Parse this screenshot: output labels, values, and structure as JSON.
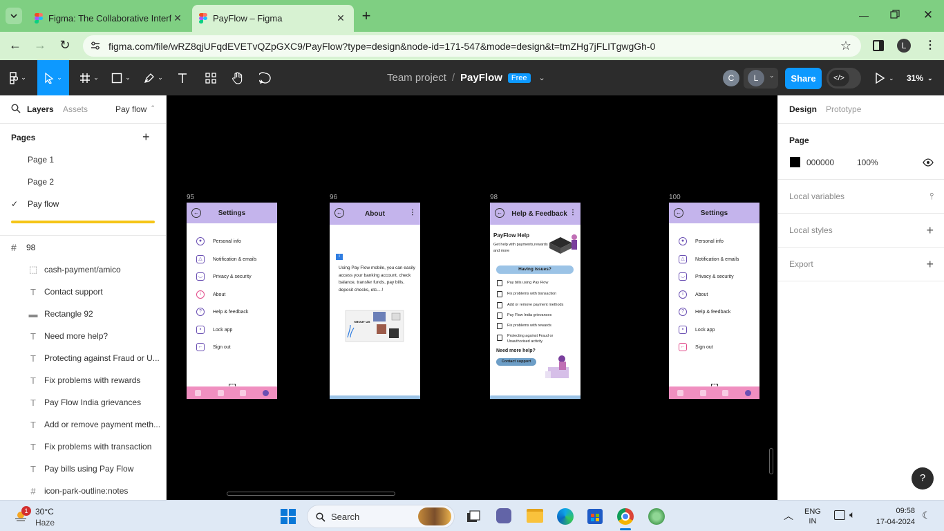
{
  "browser": {
    "tabs": [
      {
        "title": "Figma: The Collaborative Interf",
        "active": false
      },
      {
        "title": "PayFlow – Figma",
        "active": true
      }
    ],
    "url": "figma.com/file/wRZ8qjUFqdEVETvQZpGXC9/PayFlow?type=design&node-id=171-547&mode=design&t=tmZHg7jFLITgwgGh-0",
    "avatar_letter": "L"
  },
  "figma_toolbar": {
    "team": "Team project",
    "separator": "/",
    "file": "PayFlow",
    "plan_badge": "Free",
    "collab_1": "C",
    "collab_2": "L",
    "share_label": "Share",
    "zoom": "31%"
  },
  "left_panel": {
    "tab_layers": "Layers",
    "tab_assets": "Assets",
    "page_selector": "Pay flow",
    "pages_heading": "Pages",
    "pages": [
      "Page 1",
      "Page 2",
      "Pay flow"
    ],
    "frame_name": "98",
    "layers": [
      {
        "icon": "frame-dashed",
        "name": "cash-payment/amico"
      },
      {
        "icon": "text",
        "name": "Contact support"
      },
      {
        "icon": "rectangle",
        "name": "Rectangle 92"
      },
      {
        "icon": "text",
        "name": "Need more help?"
      },
      {
        "icon": "text",
        "name": "Protecting against Fraud or U..."
      },
      {
        "icon": "text",
        "name": "Fix problems with rewards"
      },
      {
        "icon": "text",
        "name": "Pay Flow India grievances"
      },
      {
        "icon": "text",
        "name": "Add or remove payment meth..."
      },
      {
        "icon": "text",
        "name": "Fix problems with transaction"
      },
      {
        "icon": "text",
        "name": "Pay bills using Pay Flow"
      },
      {
        "icon": "frame",
        "name": "icon-park-outline:notes"
      }
    ]
  },
  "right_panel": {
    "tab_design": "Design",
    "tab_prototype": "Prototype",
    "page_heading": "Page",
    "bg_color_hex": "000000",
    "bg_opacity": "100%",
    "sections": [
      "Local variables",
      "Local styles",
      "Export"
    ],
    "help": "?"
  },
  "frames": [
    {
      "label": "95",
      "title": "Settings",
      "menu": [
        "Personal info",
        "Notification & emails",
        "Privacy & security",
        "About",
        "Help & feedback",
        "Lock app",
        "Sign out"
      ]
    },
    {
      "label": "96",
      "title": "About",
      "body": "Using Pay Flow mobile, you can easily access your banking account, check balance, transfer funds, pay bills, deposit checks, etc....!",
      "illustration_text": "ABOUT US"
    },
    {
      "label": "98",
      "title": "Help & Feedback",
      "help_title": "PayFlow Help",
      "help_sub": "Get help with payments,rewards and more",
      "issues_btn": "Having issues?",
      "issues": [
        "Pay bills using Pay Flow",
        "Fix problems with transaction",
        "Add or remove payment methods",
        "Pay Flow India grievances",
        "Fix problems with rewards",
        "Protecting against Fraud or Unauthorised activity"
      ],
      "more_help": "Need more help?",
      "contact_btn": "Contact support"
    },
    {
      "label": "100",
      "title": "Settings",
      "menu": [
        "Personal info",
        "Notification & emails",
        "Privacy & security",
        "About",
        "Help & feedback",
        "Lock app",
        "Sign out"
      ]
    }
  ],
  "taskbar": {
    "weather_temp": "30°C",
    "weather_desc": "Haze",
    "weather_badge": "1",
    "search_label": "Search",
    "lang_1": "ENG",
    "lang_2": "IN",
    "time": "09:58",
    "date": "17-04-2024"
  },
  "colors": {
    "tabbar": "#7fcf82",
    "addressbar": "#d7f2d2",
    "figma_toolbar": "#2c2c2c",
    "share_button": "#0d99ff",
    "phone_header": "#c4b4ec",
    "phone_footer": "#f08fc0"
  }
}
